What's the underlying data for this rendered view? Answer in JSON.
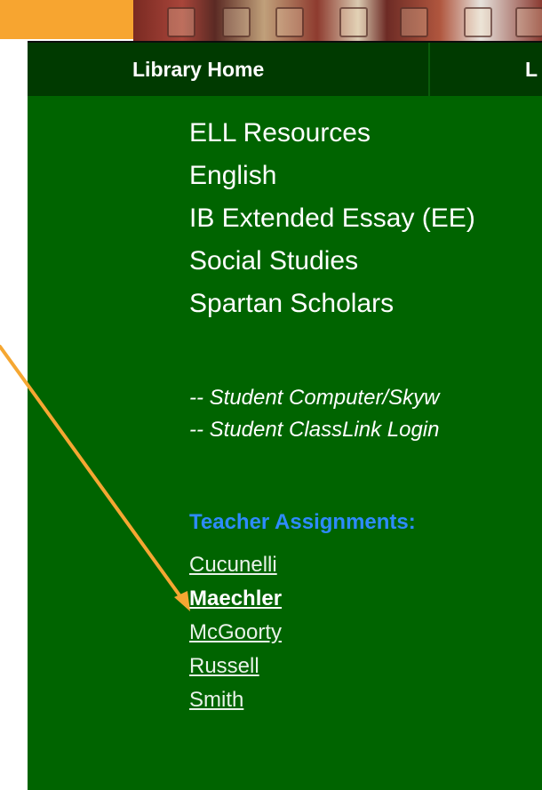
{
  "header": {
    "orange_strip_color": "#f7a530",
    "banner_name": "library-books-banner"
  },
  "navbar": {
    "home_label": "Library Home",
    "second_label": "L"
  },
  "menu": {
    "items": [
      "ELL Resources",
      "English",
      "IB Extended Essay (EE)",
      "Social Studies",
      "Spartan Scholars"
    ]
  },
  "logins": {
    "items": [
      "-- Student Computer/Skyw",
      "-- Student ClassLink Login"
    ]
  },
  "assignments": {
    "heading": "Teacher Assignments:",
    "teachers": [
      {
        "name": "Cucunelli",
        "active": false
      },
      {
        "name": "Maechler",
        "active": true
      },
      {
        "name": "McGoorty",
        "active": false
      },
      {
        "name": "Russell",
        "active": false
      },
      {
        "name": "Smith",
        "active": false
      }
    ]
  },
  "annotation": {
    "arrow_color": "#f5a732",
    "icon": "annotation-arrow"
  },
  "colors": {
    "page_green": "#006400",
    "navbar_green": "#003a00",
    "heading_blue": "#2e8bff"
  }
}
